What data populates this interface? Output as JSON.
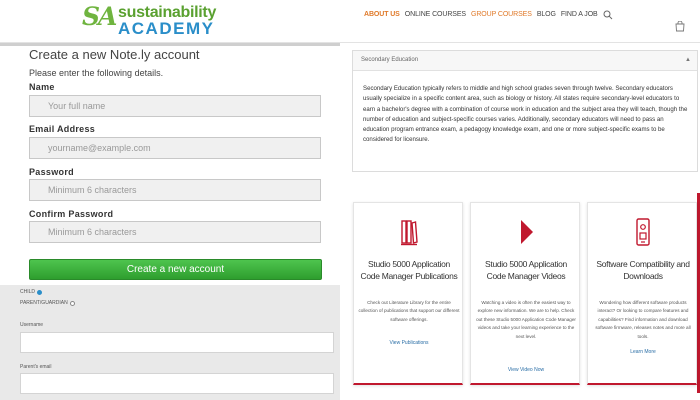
{
  "header": {
    "logo_mark": "SA",
    "logo_line1": "sustainability",
    "logo_line2": "ACADEMY",
    "nav": [
      {
        "label": "ABOUT US",
        "style": "active"
      },
      {
        "label": "ONLINE COURSES",
        "style": "normal"
      },
      {
        "label": "GROUP COURSES",
        "style": "orange"
      },
      {
        "label": "BLOG",
        "style": "normal"
      },
      {
        "label": "FIND A JOB",
        "style": "normal"
      }
    ],
    "icons": [
      "search-icon",
      "cart-icon"
    ]
  },
  "signup": {
    "title": "Create a new Note.ly account",
    "subtitle": "Please enter the following details.",
    "fields": [
      {
        "label": "Name",
        "placeholder": "Your full name"
      },
      {
        "label": "Email Address",
        "placeholder": "yourname@example.com"
      },
      {
        "label": "Password",
        "placeholder": "Minimum 6 characters"
      },
      {
        "label": "Confirm Password",
        "placeholder": "Minimum 6 characters"
      }
    ],
    "submit_label": "Create a new account"
  },
  "account_type": {
    "options": [
      {
        "label": "CHILD",
        "selected": true
      },
      {
        "label": "PARENT/GUARDIAN",
        "selected": false
      }
    ],
    "username_label": "Username",
    "parent_email_label": "Parent's email"
  },
  "accordion": {
    "title": "Secondary Education",
    "body": "Secondary Education typically refers to middle and high school grades seven through twelve. Secondary educators usually specialize in a specific content area, such as biology or history. All states require secondary-level educators to earn a bachelor's degree with a combination of course work in education and the subject area they will teach, though the number of education and subject-specific courses varies. Additionally, secondary educators will need to pass an education program entrance exam, a pedagogy knowledge exam, and one or more subject-specific exams to be considered for licensure."
  },
  "cards": [
    {
      "icon": "books-icon",
      "title": "Studio 5000 Application Code Manager Publications",
      "description": "Check out Literature Library for the entire collection of publications that support our different software offerings.",
      "link": "View Publications"
    },
    {
      "icon": "play-icon",
      "title": "Studio 5000 Application Code Manager Videos",
      "description": "Watching a video is often the easiest way to explore new information. We are to help. Check out these Studio 5000 Application Code Manager videos and take your learning experience to the next level.",
      "link": "View Video Now"
    },
    {
      "icon": "compatibility-icon",
      "title": "Software Compatibility and Downloads",
      "description": "Wondering how different software products interact? Or looking to compare features and capabilities? Find information and download software firmware, releases notes and more all tools.",
      "link": "Learn More"
    }
  ],
  "colors": {
    "brand_green": "#5aa130",
    "brand_blue": "#2a8ec9",
    "nav_orange": "#e07a2a",
    "accent_red": "#c0182e",
    "button_green": "#3bb03b"
  }
}
